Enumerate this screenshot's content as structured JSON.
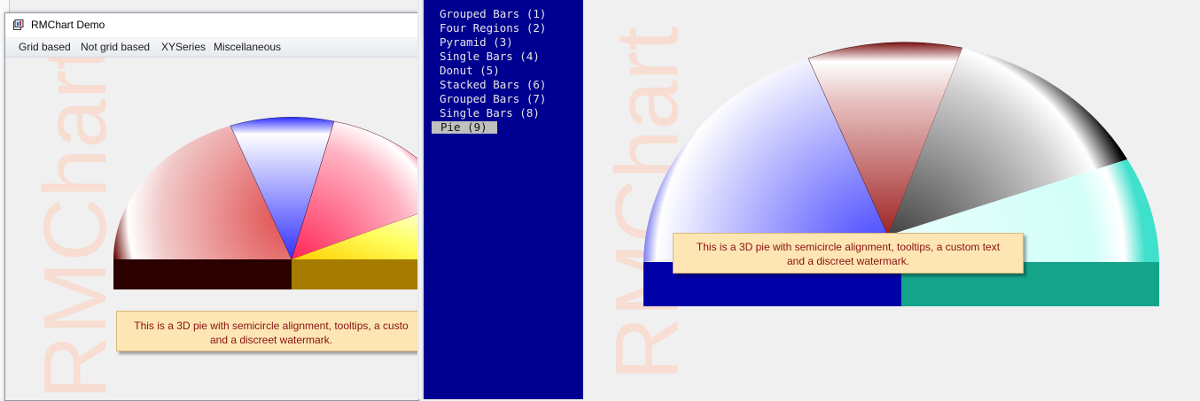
{
  "window": {
    "title": "RMChart Demo",
    "menu": [
      "Grid based",
      "Not grid based",
      "XYSeries",
      "Miscellaneous"
    ]
  },
  "watermark_text": "RMChart",
  "chart_caption": {
    "line1": "This is a 3D pie with semicircle alignment, tooltips, a custom text",
    "line2": "and a discreet watermark.",
    "left_line1": "This is a 3D pie with semicircle alignment, tooltips, a custo"
  },
  "chart_menu": {
    "items": [
      "Grouped Bars (1)",
      "Four Regions (2)",
      "Pyramid (3)",
      "Single Bars (4)",
      "Donut (5)",
      "Stacked Bars (6)",
      "Grouped Bars (7)",
      "Single Bars (8)",
      "Pie (9)"
    ],
    "selected_index": 8
  },
  "chart_data": [
    {
      "type": "pie",
      "alignment": "semicircle",
      "three_d": true,
      "title": "",
      "slice_colors": [
        "#b21818",
        "#3a3aff",
        "#ff2c66",
        "#ffee22"
      ],
      "slice_fractions": [
        0.31,
        0.19,
        0.26,
        0.24
      ],
      "visible": "partially clipped at right edge"
    },
    {
      "type": "pie",
      "alignment": "semicircle",
      "three_d": true,
      "title": "",
      "slice_colors": [
        "#3a3aff",
        "#b03030",
        "#3c3c3c",
        "#cffcf6"
      ],
      "slice_fractions": [
        0.32,
        0.18,
        0.29,
        0.21
      ]
    }
  ]
}
